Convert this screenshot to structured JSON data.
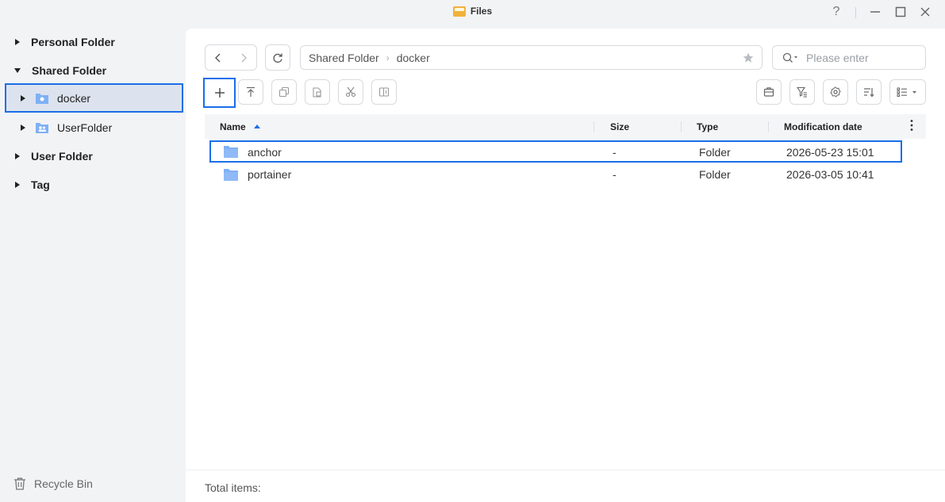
{
  "window": {
    "title": "Files",
    "app_icon": "files-app-icon",
    "controls": [
      "help-icon",
      "minimize-icon",
      "maximize-icon",
      "close-icon"
    ]
  },
  "sidebar": {
    "items": [
      {
        "label": "Personal Folder",
        "level": 0,
        "expanded": false
      },
      {
        "label": "Shared Folder",
        "level": 0,
        "expanded": true
      },
      {
        "label": "docker",
        "level": 1,
        "selected": true,
        "icon": "shared-folder-icon"
      },
      {
        "label": "UserFolder",
        "level": 1,
        "icon": "user-folder-icon"
      },
      {
        "label": "User Folder",
        "level": 0,
        "expanded": false
      },
      {
        "label": "Tag",
        "level": 0,
        "expanded": false
      }
    ],
    "recycle_bin": "Recycle Bin"
  },
  "path": {
    "root": "Shared Folder",
    "current": "docker"
  },
  "search": {
    "placeholder": "Please enter"
  },
  "table": {
    "columns": {
      "name": "Name",
      "size": "Size",
      "type": "Type",
      "modified": "Modification date"
    },
    "sort": "name-ascending",
    "rows": [
      {
        "name": "anchor",
        "size": "-",
        "type": "Folder",
        "modified": "2026-05-23 15:01",
        "highlighted": true
      },
      {
        "name": "portainer",
        "size": "-",
        "type": "Folder",
        "modified": "2026-03-05 10:41"
      }
    ]
  },
  "footer": {
    "total_items": "Total items:"
  },
  "colors": {
    "accent": "#1a6ee8",
    "folder": "#7fb0f5",
    "selected_bg": "#dce3ee"
  }
}
